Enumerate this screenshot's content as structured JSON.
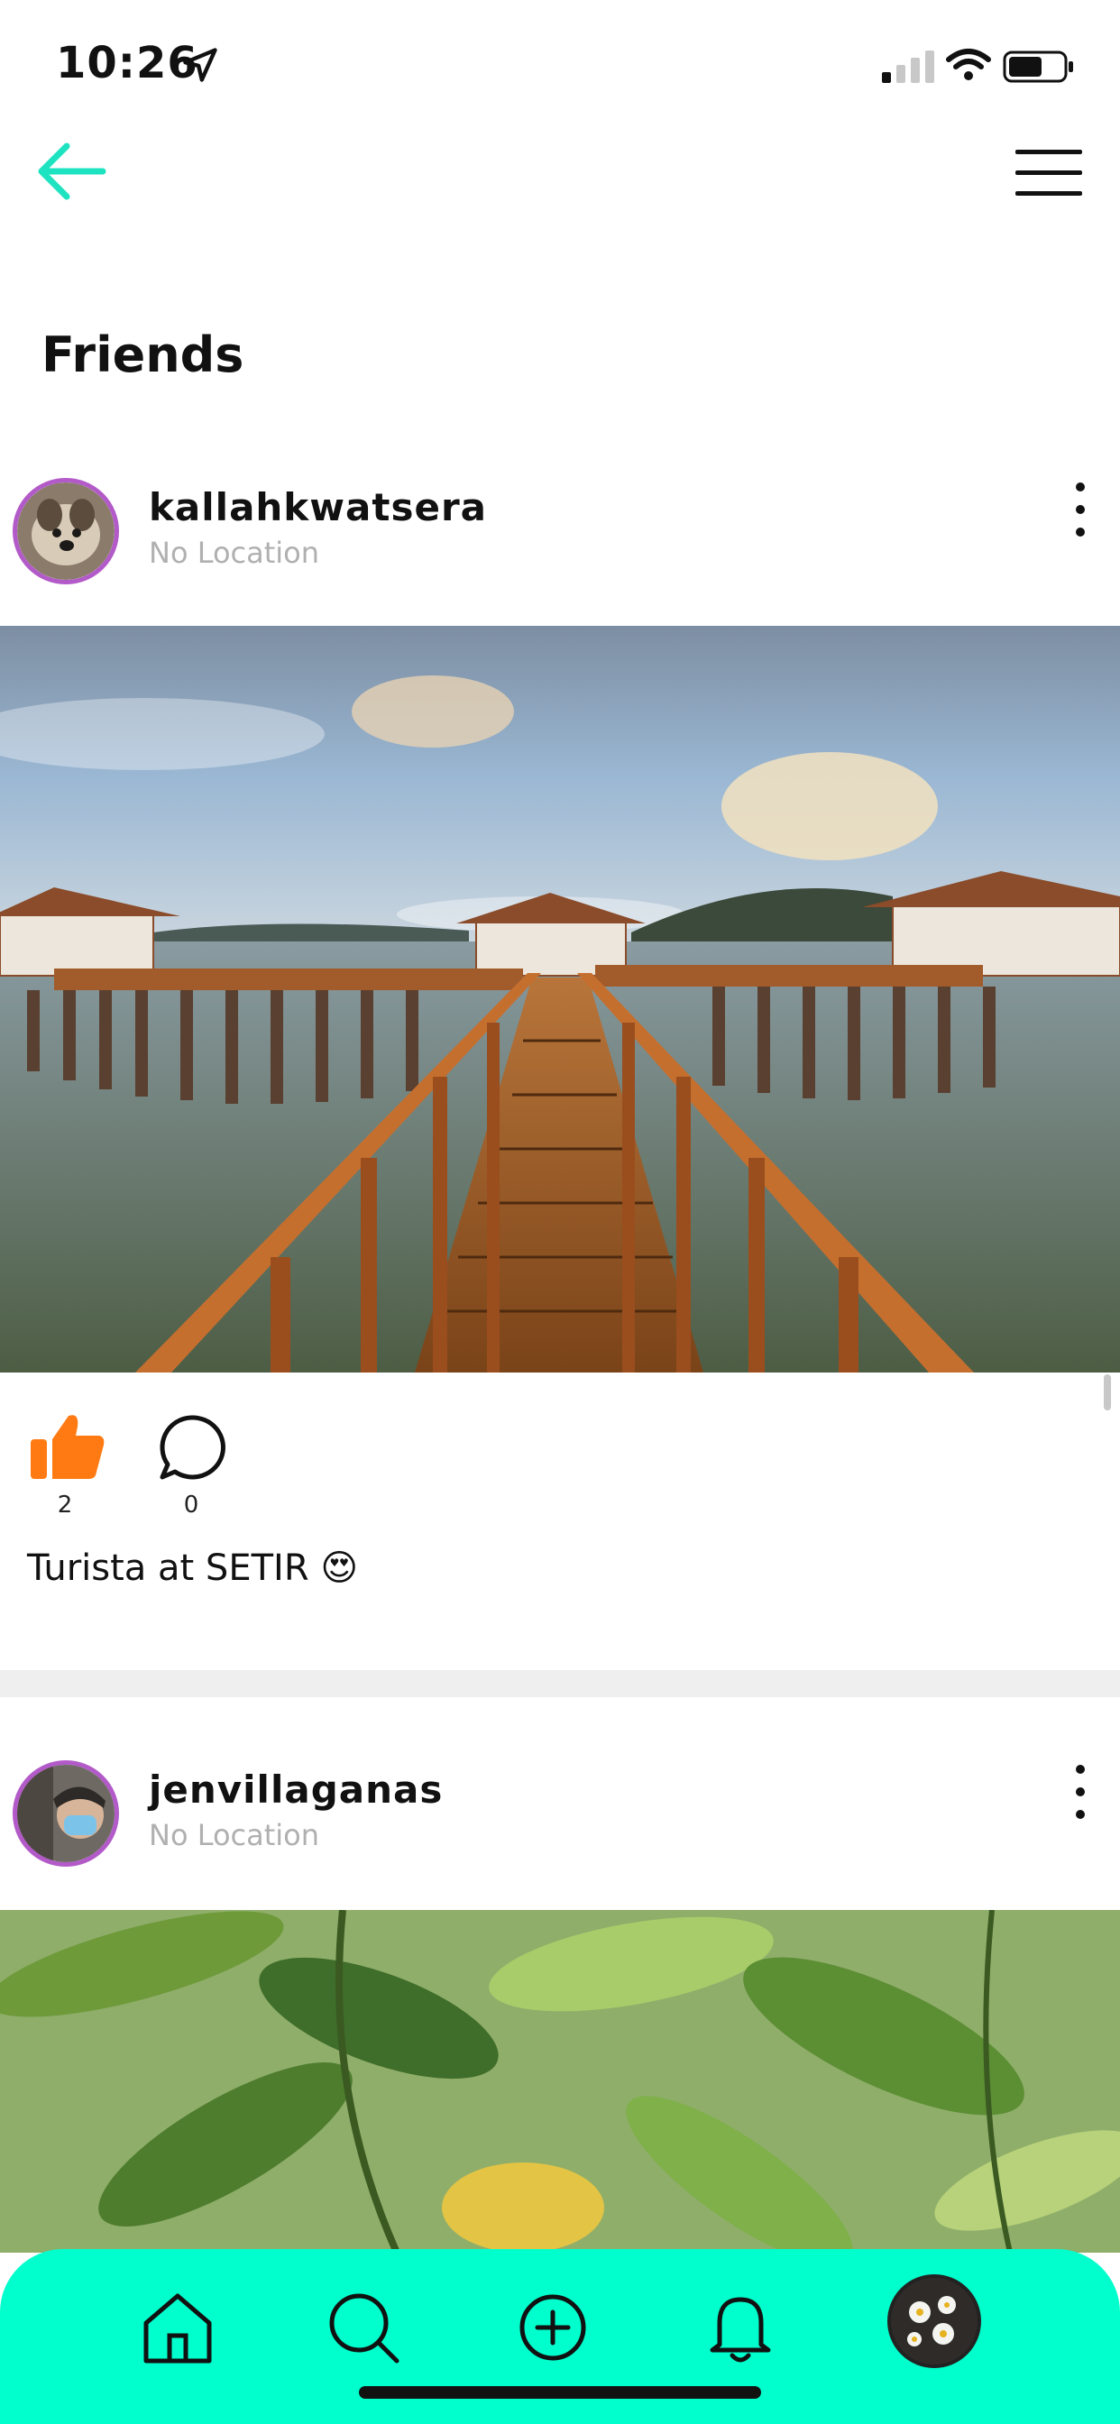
{
  "status_bar": {
    "time": "10:26"
  },
  "nav": {
    "back_icon": "arrow-left-icon",
    "menu_icon": "hamburger-icon",
    "accent": "#1ee3c0"
  },
  "section_title": "Friends",
  "posts": [
    {
      "username": "kallahkwatsera",
      "location": "No Location",
      "photo": "wooden boardwalk pier over water with cottages at sunset",
      "likes": "2",
      "comments": "0",
      "caption": "Turista at SETIR 😍",
      "like_color": "#ff7a12"
    },
    {
      "username": "jenvillaganas",
      "location": "No Location",
      "photo": "green leaves close-up"
    }
  ],
  "tab_bar": {
    "color": "#00ffcc",
    "tabs": [
      "home-icon",
      "search-icon",
      "add-post-icon",
      "notifications-icon",
      "profile-avatar"
    ]
  }
}
